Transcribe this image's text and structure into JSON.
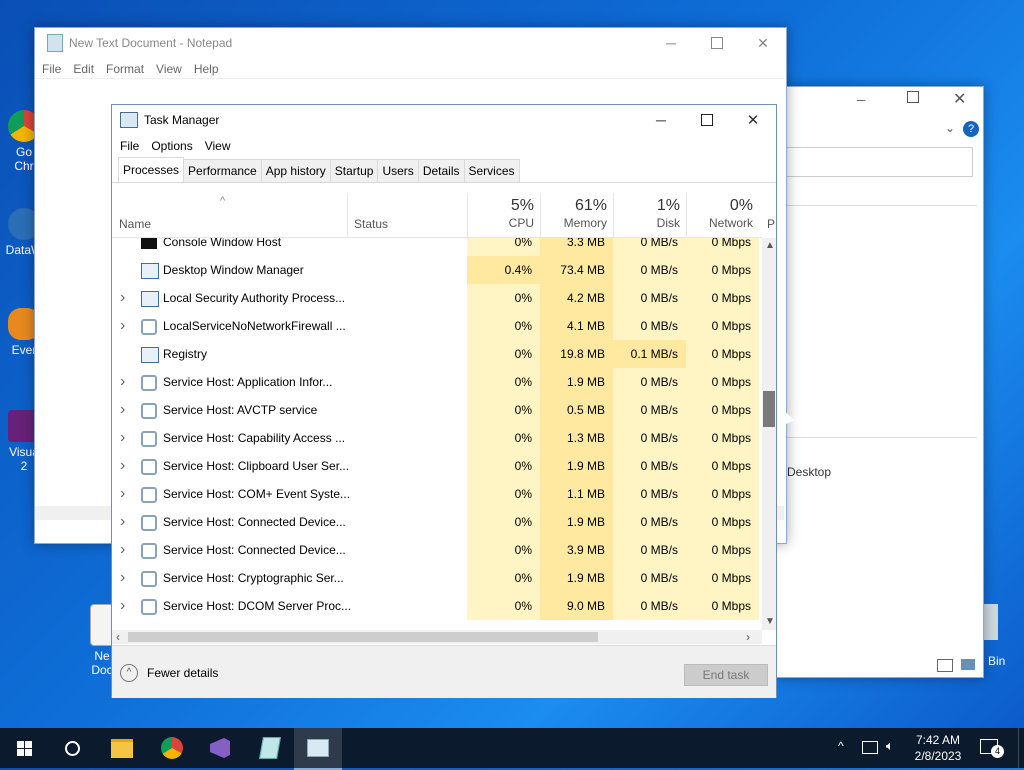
{
  "desktop": {
    "icons": [
      {
        "name": "chrome-desktop-icon",
        "label": "Go\nChr"
      },
      {
        "name": "datawrapper-desktop-icon",
        "label": "DataW"
      },
      {
        "name": "evernote-desktop-icon",
        "label": "Ever"
      },
      {
        "name": "visual-studio-desktop-icon",
        "label": "Visua\n2"
      },
      {
        "name": "new-doc-desktop-icon",
        "label": "Ne\nDoc"
      }
    ],
    "recycle_bin_label": "e Bin"
  },
  "notepad": {
    "title": "New Text Document - Notepad",
    "menu": [
      "File",
      "Edit",
      "Format",
      "View",
      "Help"
    ]
  },
  "explorer_behind": {
    "desktop_label": "Desktop"
  },
  "task_manager": {
    "title": "Task Manager",
    "menu": [
      "File",
      "Options",
      "View"
    ],
    "tabs": [
      "Processes",
      "Performance",
      "App history",
      "Startup",
      "Users",
      "Details",
      "Services"
    ],
    "active_tab": "Processes",
    "columns": {
      "name": "Name",
      "status": "Status",
      "cpu": {
        "pct": "5%",
        "label": "CPU"
      },
      "memory": {
        "pct": "61%",
        "label": "Memory"
      },
      "disk": {
        "pct": "1%",
        "label": "Disk"
      },
      "network": {
        "pct": "0%",
        "label": "Network"
      },
      "power_clip": "P"
    },
    "rows": [
      {
        "name": "Console Window Host",
        "expandable": false,
        "icon": "console",
        "cpu": "0%",
        "memory": "3.3 MB",
        "disk": "0 MB/s",
        "network": "0 Mbps"
      },
      {
        "name": "Desktop Window Manager",
        "expandable": false,
        "icon": "window",
        "cpu": "0.4%",
        "memory": "73.4 MB",
        "disk": "0 MB/s",
        "network": "0 Mbps"
      },
      {
        "name": "Local Security Authority Process...",
        "expandable": true,
        "icon": "window",
        "cpu": "0%",
        "memory": "4.2 MB",
        "disk": "0 MB/s",
        "network": "0 Mbps"
      },
      {
        "name": "LocalServiceNoNetworkFirewall ...",
        "expandable": true,
        "icon": "gear",
        "cpu": "0%",
        "memory": "4.1 MB",
        "disk": "0 MB/s",
        "network": "0 Mbps"
      },
      {
        "name": "Registry",
        "expandable": false,
        "icon": "window",
        "cpu": "0%",
        "memory": "19.8 MB",
        "disk": "0.1 MB/s",
        "network": "0 Mbps"
      },
      {
        "name": "Service Host: Application Infor...",
        "expandable": true,
        "icon": "gear",
        "cpu": "0%",
        "memory": "1.9 MB",
        "disk": "0 MB/s",
        "network": "0 Mbps"
      },
      {
        "name": "Service Host: AVCTP service",
        "expandable": true,
        "icon": "gear",
        "cpu": "0%",
        "memory": "0.5 MB",
        "disk": "0 MB/s",
        "network": "0 Mbps"
      },
      {
        "name": "Service Host: Capability Access ...",
        "expandable": true,
        "icon": "gear",
        "cpu": "0%",
        "memory": "1.3 MB",
        "disk": "0 MB/s",
        "network": "0 Mbps"
      },
      {
        "name": "Service Host: Clipboard User Ser...",
        "expandable": true,
        "icon": "gear",
        "cpu": "0%",
        "memory": "1.9 MB",
        "disk": "0 MB/s",
        "network": "0 Mbps"
      },
      {
        "name": "Service Host: COM+ Event Syste...",
        "expandable": true,
        "icon": "gear",
        "cpu": "0%",
        "memory": "1.1 MB",
        "disk": "0 MB/s",
        "network": "0 Mbps"
      },
      {
        "name": "Service Host: Connected Device...",
        "expandable": true,
        "icon": "gear",
        "cpu": "0%",
        "memory": "1.9 MB",
        "disk": "0 MB/s",
        "network": "0 Mbps"
      },
      {
        "name": "Service Host: Connected Device...",
        "expandable": true,
        "icon": "gear",
        "cpu": "0%",
        "memory": "3.9 MB",
        "disk": "0 MB/s",
        "network": "0 Mbps"
      },
      {
        "name": "Service Host: Cryptographic Ser...",
        "expandable": true,
        "icon": "gear",
        "cpu": "0%",
        "memory": "1.9 MB",
        "disk": "0 MB/s",
        "network": "0 Mbps"
      },
      {
        "name": "Service Host: DCOM Server Proc...",
        "expandable": true,
        "icon": "gear",
        "cpu": "0%",
        "memory": "9.0 MB",
        "disk": "0 MB/s",
        "network": "0 Mbps"
      }
    ],
    "fewer_details": "Fewer details",
    "end_task": "End task"
  },
  "taskbar": {
    "time": "7:42 AM",
    "date": "2/8/2023",
    "notification_count": "4",
    "apps": [
      "file-explorer-icon",
      "chrome-icon",
      "visual-studio-icon",
      "notepad-icon",
      "task-manager-icon"
    ]
  },
  "colors": {
    "heat_light": "#fff4c4",
    "heat_med": "#ffe9a0",
    "accent": "#0078d7"
  }
}
